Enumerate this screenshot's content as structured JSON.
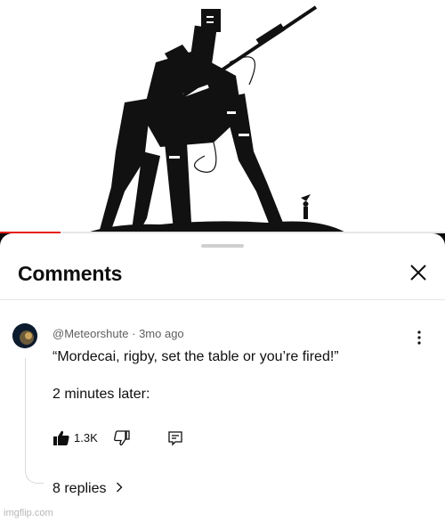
{
  "video": {
    "progress_fraction": 0.135,
    "progress_color": "#e62117"
  },
  "sheet": {
    "title": "Comments",
    "close_icon": "close-icon"
  },
  "comment": {
    "author": "@Meteorshute",
    "separator": "·",
    "time": "3mo ago",
    "text": "“Mordecai, rigby, set the table or you’re fired!”\n\n2 minutes later:",
    "likes": "1.3K",
    "replies_label": "8 replies",
    "icons": [
      "avatar",
      "more-vert-icon",
      "thumb-up-icon",
      "thumb-down-icon",
      "reply-icon",
      "chevron-right-icon"
    ]
  },
  "watermark": "imgflip.com"
}
